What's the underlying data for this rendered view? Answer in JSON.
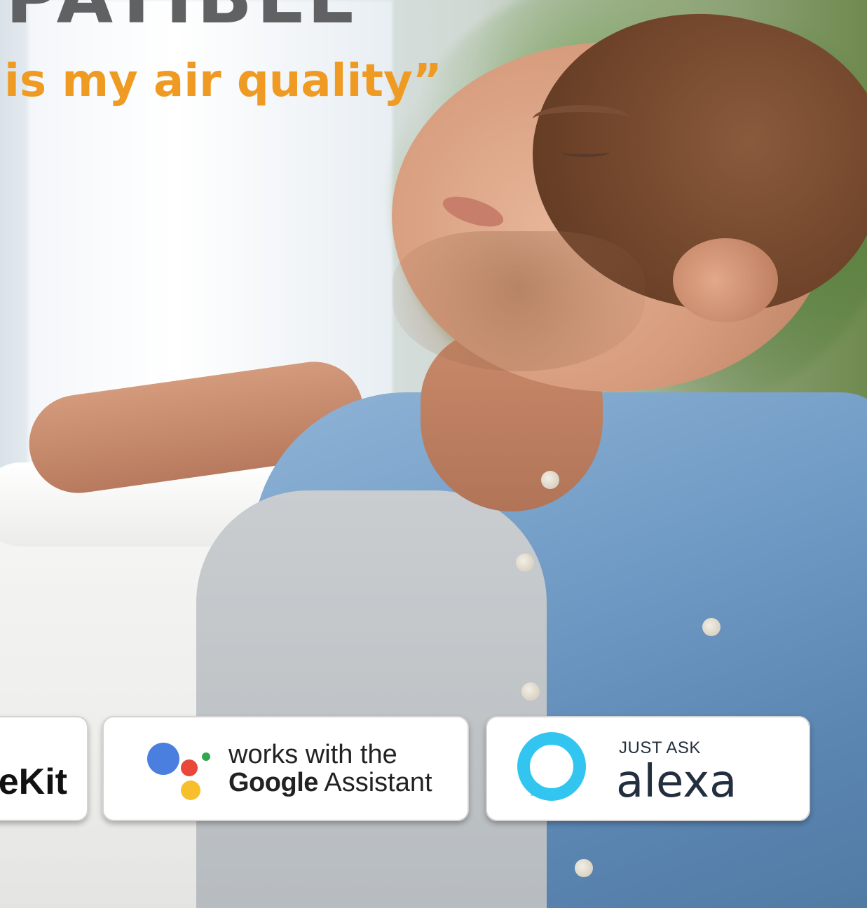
{
  "headline": {
    "text": "PATIBLE",
    "color": "#5f6163"
  },
  "tagline": {
    "text": "is my air quality”",
    "color": "#ef9a22"
  },
  "badges": {
    "homekit": {
      "text": "eKit"
    },
    "google": {
      "line1": "works with the",
      "brand": "Google",
      "suffix": "Assistant",
      "colors": {
        "blue": "#4a7fe0",
        "red": "#e8473a",
        "yellow": "#f7bf2b",
        "green": "#2fa84f"
      }
    },
    "alexa": {
      "top": "JUST ASK",
      "word": "alexa",
      "ring_color": "#31c5f0"
    }
  }
}
